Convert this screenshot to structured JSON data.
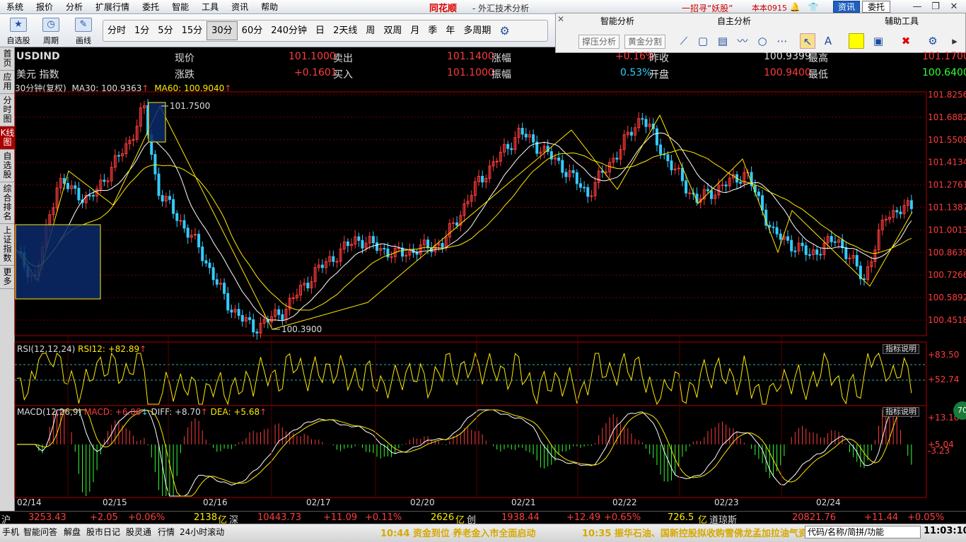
{
  "menu": [
    "系统",
    "报价",
    "分析",
    "扩展行情",
    "委托",
    "智能",
    "工具",
    "资讯",
    "帮助"
  ],
  "brand": "同花顺",
  "subtitle": "- 外汇技术分析",
  "promo": "一招寻“妖股”",
  "version": "本本0915",
  "top_buttons": {
    "zixun": "资讯",
    "weituo": "委托"
  },
  "toolbar": {
    "tools": [
      {
        "icon": "★",
        "label": "自选股"
      },
      {
        "icon": "◷",
        "label": "周期"
      },
      {
        "icon": "✎",
        "label": "画线"
      }
    ],
    "periods": [
      "分时",
      "1分",
      "5分",
      "15分",
      "30分",
      "60分",
      "240分钟",
      "日",
      "2天线",
      "周",
      "双周",
      "月",
      "季",
      "年",
      "多周期"
    ],
    "active_period": "30分",
    "gear": "⚙"
  },
  "panel": {
    "smart": "智能分析",
    "custom": "自主分析",
    "aux": "辅助工具",
    "btn_pressure": "撑压分析",
    "btn_golden": "黄金分割"
  },
  "leftnav": [
    {
      "label": "首页",
      "active": false
    },
    {
      "label": "应用",
      "active": false
    },
    {
      "label": "分时图",
      "active": false
    },
    {
      "label": "K线图",
      "active": true
    },
    {
      "label": "自选股",
      "active": false
    },
    {
      "label": "综合排名",
      "active": false
    },
    {
      "label": "上证指数",
      "active": false
    },
    {
      "label": "更多",
      "active": false
    }
  ],
  "quote": {
    "symbol": "USDIND",
    "name": "美元 指数",
    "xj_l": "现价",
    "xj_v": "101.1000",
    "mc_l": "卖出",
    "mc_v": "101.1400",
    "zf_l": "涨幅",
    "zf_v": "+0.16%",
    "zs_l": "昨收",
    "zs_v": "100.9399",
    "zg_l": "最高",
    "zg_v": "101.1700",
    "zd_l": "涨跌",
    "zd_v": "+0.1601",
    "mr_l": "买入",
    "mr_v": "101.1000",
    "zf2_l": "振幅",
    "zf2_v": "0.53%",
    "kp_l": "开盘",
    "kp_v": "100.9400",
    "zd2_l": "最低",
    "zd2_v": "100.6400"
  },
  "kline_info": {
    "period": "30分钟(复权)",
    "ma30": "MA30: 100.9363",
    "ma60": "MA60: 100.9040"
  },
  "price_axis": [
    "101.8256",
    "101.6882",
    "101.5508",
    "101.4134",
    "101.2761",
    "101.1387",
    "101.0013",
    "100.8639",
    "100.7266",
    "100.5892",
    "100.4518"
  ],
  "chart_labels": {
    "high": "101.7500",
    "low": "100.3900"
  },
  "rsi": {
    "title": "RSI(12,12,24)",
    "value": "RSI12: +82.89",
    "axis": [
      "+83.50",
      "+52.74"
    ],
    "btn": "指标说明"
  },
  "macd": {
    "title": "MACD(12,26,9)",
    "macd": "MACD: +6.06",
    "diff": "DIFF: +8.70",
    "dea": "DEA: +5.68",
    "axis": [
      "+13.10",
      "+5.04",
      "-3.23"
    ],
    "btn": "指标说明"
  },
  "dates": [
    "02/14",
    "02/15",
    "02/16",
    "02/17",
    "02/20",
    "02/21",
    "02/22",
    "02/23",
    "02/24"
  ],
  "status": {
    "hu": "沪",
    "hu_v": "3253.43",
    "hu_c": "+2.05",
    "hu_p": "+0.06%",
    "hu_a": "2138",
    "yi": "亿",
    "shen": "深",
    "shen_v": "10443.73",
    "shen_c": "+11.09",
    "shen_p": "+0.11%",
    "shen_a": "2626",
    "chuang": "创",
    "cy_v": "1938.44",
    "cy_c": "+12.49",
    "cy_p": "+0.65%",
    "cy_a": "726.5",
    "dqs": "道琼斯",
    "dqs_v": "20821.76",
    "dqs_c": "+11.44",
    "dqs_p": "+0.05%"
  },
  "bottom": {
    "items": [
      "手机",
      "智能问答",
      "解盘",
      "股市日记",
      "股灵通",
      "行情",
      "24小时滚动"
    ],
    "ticker1": "10:44 资金到位 养老金入市全面启动",
    "ticker2": "10:35 振华石油、国新控股拟收购雪佛龙孟加拉油气资",
    "search": "代码/名称/简拼/功能",
    "clock": "11:03:10"
  },
  "badge": "70",
  "colors": {
    "up": "#ff3c3c",
    "down": "#3cf",
    "ma": "#ffea00",
    "ma2": "#ffffff",
    "box": "#0a2a6a"
  }
}
